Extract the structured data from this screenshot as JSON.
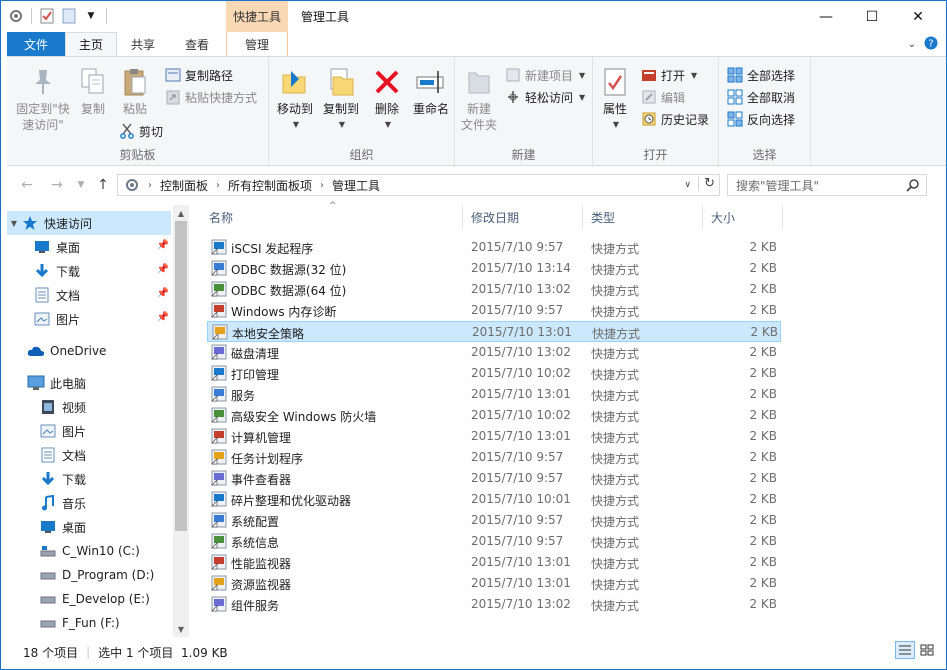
{
  "window": {
    "title": "管理工具",
    "context_tab_header": "快捷工具",
    "controls": {
      "minimize": "—",
      "maximize": "☐",
      "close": "✕"
    }
  },
  "tabs": [
    {
      "label": "文件"
    },
    {
      "label": "主页"
    },
    {
      "label": "共享"
    },
    {
      "label": "查看"
    },
    {
      "label": "管理"
    }
  ],
  "ribbon": {
    "clipboard": {
      "label": "剪贴板",
      "pin_quick_access": "固定到\"快速访问\"",
      "copy": "复制",
      "paste": "粘贴",
      "copy_path": "复制路径",
      "paste_shortcut": "粘贴快捷方式",
      "cut": "剪切"
    },
    "organize": {
      "label": "组织",
      "move_to": "移动到",
      "copy_to": "复制到",
      "delete": "删除",
      "rename": "重命名"
    },
    "new": {
      "label": "新建",
      "new_folder": "新建\n文件夹",
      "new_item": "新建项目",
      "easy_access": "轻松访问"
    },
    "open": {
      "label": "打开",
      "properties": "属性",
      "open": "打开",
      "edit": "编辑",
      "history": "历史记录"
    },
    "select": {
      "label": "选择",
      "select_all": "全部选择",
      "select_none": "全部取消",
      "invert": "反向选择"
    }
  },
  "address": {
    "crumbs": [
      "控制面板",
      "所有控制面板项",
      "管理工具"
    ],
    "search_placeholder": "搜索\"管理工具\""
  },
  "nav": {
    "quick_access": "快速访问",
    "qa_items": [
      "桌面",
      "下载",
      "文档",
      "图片"
    ],
    "onedrive": "OneDrive",
    "this_pc": "此电脑",
    "pc_items": [
      "视频",
      "图片",
      "文档",
      "下载",
      "音乐",
      "桌面",
      "C_Win10 (C:)",
      "D_Program (D:)",
      "E_Develop (E:)",
      "F_Fun (F:)"
    ]
  },
  "columns": {
    "name": "名称",
    "date": "修改日期",
    "type": "类型",
    "size": "大小"
  },
  "files": [
    {
      "name": "iSCSI 发起程序",
      "date": "2015/7/10 9:57",
      "type": "快捷方式",
      "size": "2 KB",
      "icon": "iscsi-icon"
    },
    {
      "name": "ODBC 数据源(32 位)",
      "date": "2015/7/10 13:14",
      "type": "快捷方式",
      "size": "2 KB",
      "icon": "odbc-icon"
    },
    {
      "name": "ODBC 数据源(64 位)",
      "date": "2015/7/10 13:02",
      "type": "快捷方式",
      "size": "2 KB",
      "icon": "odbc-icon"
    },
    {
      "name": "Windows 内存诊断",
      "date": "2015/7/10 9:57",
      "type": "快捷方式",
      "size": "2 KB",
      "icon": "memory-diagnostic-icon"
    },
    {
      "name": "本地安全策略",
      "date": "2015/7/10 13:01",
      "type": "快捷方式",
      "size": "2 KB",
      "icon": "security-policy-icon"
    },
    {
      "name": "磁盘清理",
      "date": "2015/7/10 13:02",
      "type": "快捷方式",
      "size": "2 KB",
      "icon": "disk-cleanup-icon"
    },
    {
      "name": "打印管理",
      "date": "2015/7/10 10:02",
      "type": "快捷方式",
      "size": "2 KB",
      "icon": "print-management-icon"
    },
    {
      "name": "服务",
      "date": "2015/7/10 13:01",
      "type": "快捷方式",
      "size": "2 KB",
      "icon": "services-icon"
    },
    {
      "name": "高级安全 Windows 防火墙",
      "date": "2015/7/10 10:02",
      "type": "快捷方式",
      "size": "2 KB",
      "icon": "firewall-icon"
    },
    {
      "name": "计算机管理",
      "date": "2015/7/10 13:01",
      "type": "快捷方式",
      "size": "2 KB",
      "icon": "computer-management-icon"
    },
    {
      "name": "任务计划程序",
      "date": "2015/7/10 9:57",
      "type": "快捷方式",
      "size": "2 KB",
      "icon": "task-scheduler-icon"
    },
    {
      "name": "事件查看器",
      "date": "2015/7/10 9:57",
      "type": "快捷方式",
      "size": "2 KB",
      "icon": "event-viewer-icon"
    },
    {
      "name": "碎片整理和优化驱动器",
      "date": "2015/7/10 10:01",
      "type": "快捷方式",
      "size": "2 KB",
      "icon": "defrag-icon"
    },
    {
      "name": "系统配置",
      "date": "2015/7/10 9:57",
      "type": "快捷方式",
      "size": "2 KB",
      "icon": "system-config-icon"
    },
    {
      "name": "系统信息",
      "date": "2015/7/10 9:57",
      "type": "快捷方式",
      "size": "2 KB",
      "icon": "system-info-icon"
    },
    {
      "name": "性能监视器",
      "date": "2015/7/10 13:01",
      "type": "快捷方式",
      "size": "2 KB",
      "icon": "performance-monitor-icon"
    },
    {
      "name": "资源监视器",
      "date": "2015/7/10 13:01",
      "type": "快捷方式",
      "size": "2 KB",
      "icon": "resource-monitor-icon"
    },
    {
      "name": "组件服务",
      "date": "2015/7/10 13:02",
      "type": "快捷方式",
      "size": "2 KB",
      "icon": "component-services-icon"
    }
  ],
  "selected_file": "本地安全策略",
  "status": {
    "count": "18 个项目",
    "selection": "选中 1 个项目  1.09 KB"
  },
  "colors": {
    "accent": "#1979ca",
    "selection": "#cce8ff",
    "context_tab": "#f9d9b5"
  }
}
